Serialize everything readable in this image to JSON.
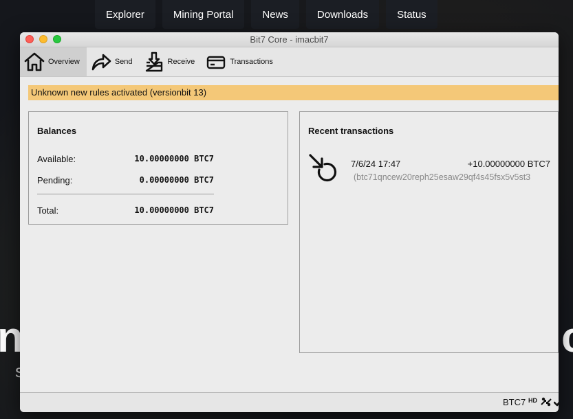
{
  "site": {
    "nav": [
      "Explorer",
      "Mining Portal",
      "News",
      "Downloads",
      "Status"
    ],
    "hero_left_fragment": "n",
    "hero_right_fragment": "c",
    "hero_sub_fragment": "s"
  },
  "window": {
    "title": "Bit7 Core - imacbit7"
  },
  "toolbar": {
    "overview": "Overview",
    "send": "Send",
    "receive": "Receive",
    "transactions": "Transactions"
  },
  "warning": "Unknown new rules activated (versionbit 13)",
  "balances": {
    "title": "Balances",
    "available_label": "Available:",
    "available_value": "10.00000000 BTC7",
    "pending_label": "Pending:",
    "pending_value": "0.00000000 BTC7",
    "total_label": "Total:",
    "total_value": "10.00000000 BTC7"
  },
  "recent": {
    "title": "Recent transactions",
    "items": [
      {
        "date": "7/6/24 17:47",
        "amount": "+10.00000000 BTC7",
        "address": "(btc71qncew20reph25esaw29qf4s45fsx5v5st3"
      }
    ]
  },
  "status": {
    "unit": "BTC7",
    "hd": "HD"
  },
  "colors": {
    "warning_bg": "#f4c878",
    "window_bg": "#ececec"
  }
}
